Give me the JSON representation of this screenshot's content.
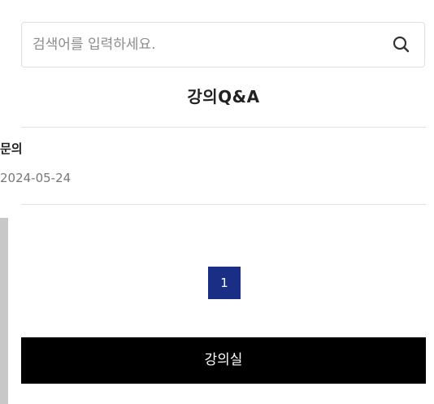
{
  "search": {
    "placeholder": "검색어를 입력하세요.",
    "value": "",
    "icon": "search-icon"
  },
  "board": {
    "title": "강의Q&A"
  },
  "posts": [
    {
      "title": "문의",
      "date": "2024-05-24"
    }
  ],
  "pagination": {
    "current": "1"
  },
  "actions": {
    "classroom_label": "강의실"
  },
  "colors": {
    "page_active": "#1b2e86",
    "classroom_button": "#000000"
  }
}
